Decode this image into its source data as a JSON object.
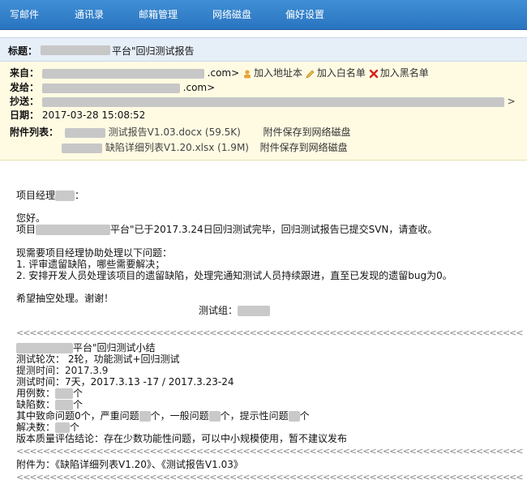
{
  "nav": {
    "items": [
      "写邮件",
      "通讯录",
      "邮箱管理",
      "网络磁盘",
      "偏好设置"
    ]
  },
  "subject": {
    "label": "标题：",
    "text": "平台\"回归测试报告"
  },
  "header": {
    "from_label": "来自：",
    "from_suffix": ".com>",
    "add_address_book": "加入地址本",
    "add_whitelist": "加入白名单",
    "add_blacklist": "加入黑名单",
    "to_label": "发给：",
    "to_suffix": ".com>",
    "cc_label": "抄送：",
    "date_label": "日期：",
    "date_value": "2017-03-28 15:08:52",
    "attach_label": "附件列表：",
    "attachments": [
      {
        "name": "测试报告V1.03.docx (59.5K)",
        "action": "附件保存到网络磁盘"
      },
      {
        "name": "缺陷详细列表V1.20.xlsx (1.9M)",
        "action": "附件保存到网络磁盘"
      }
    ]
  },
  "body": {
    "greeting": "项目经理",
    "greeting_colon": "：",
    "hello": "您好。",
    "line1_a": "项目",
    "line1_b": "平台\"已于2017.3.24日回归测试完毕，回归测试报告已提交SVN，请查收。",
    "line2": "现需要项目经理协助处理以下问题：",
    "item1": "1. 评审遗留缺陷，哪些需要解决；",
    "item2": "2. 安排开发人员处理该项目的遗留缺陷，处理完通知测试人员持续跟进，直至已发现的遗留bug为0。",
    "hope": "希望抽空处理。谢谢！",
    "team": "测试组：",
    "separator": "<<<<<<<<<<<<<<<<<<<<<<<<<<<<<<<<<<<<<<<<<<<<<<<<<<<<<<<<<<<<<<<<<<<<<<<<<<<<",
    "summary_title": "平台\"回归测试小结",
    "round": "测试轮次： 2轮，功能测试+回归测试",
    "submit_time": "提测时间：2017.3.9",
    "test_time": "测试时间：7天，2017.3.13 -17 / 2017.3.23-24",
    "cases": "用例数：",
    "cases_unit": "个",
    "defects": "缺陷数：",
    "defects_unit": "个",
    "severity_a": "其中致命问题0个，严重问题",
    "severity_b": "个，一般问题",
    "severity_c": "个，提示性问题",
    "severity_d": "个",
    "solved": "解决数：",
    "solved_unit": "个",
    "conclusion": "版本质量评估结论：存在少数功能性问题，可以中小规模使用，暂不建议发布",
    "attachments_line": "附件为：《缺陷详细列表V1.20》、《测试报告V1.03》"
  }
}
